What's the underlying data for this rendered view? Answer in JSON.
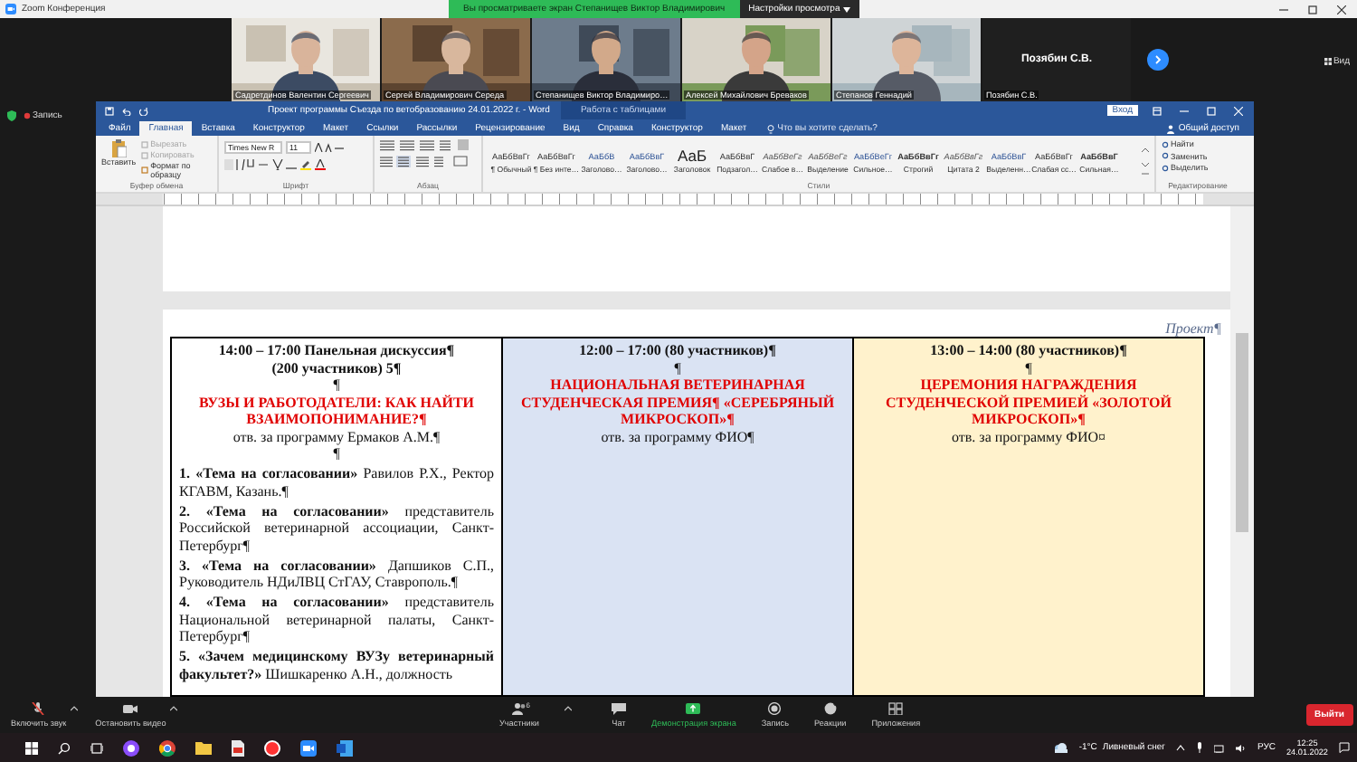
{
  "window": {
    "title": "Zoom Конференция"
  },
  "share_banner": {
    "text": "Вы просматриваете экран Степанищев Виктор Владимирович",
    "menu": "Настройки просмотра"
  },
  "participants": [
    {
      "kind": "video",
      "name": "Садретдинов Валентин Сергеевич"
    },
    {
      "kind": "video",
      "name": "Сергей Владимирович Середа"
    },
    {
      "kind": "video",
      "name": "Степанищев Виктор Владимиро…"
    },
    {
      "kind": "video",
      "name": "Алексей Михайлович Бреваков"
    },
    {
      "kind": "video",
      "name": "Степанов Геннадий"
    },
    {
      "kind": "name",
      "name": "Позябин С.В.",
      "caption": "Позябин С.В."
    }
  ],
  "view_button": "Вид",
  "recording": "Запись",
  "word": {
    "title": "Проект программы Съезда по ветобразованию 24.01.2022 г. - Word",
    "context_tab": "Работа с таблицами",
    "signin": "Вход",
    "tabs": [
      {
        "label": "Файл",
        "selected": false
      },
      {
        "label": "Главная",
        "selected": true
      },
      {
        "label": "Вставка",
        "selected": false
      },
      {
        "label": "Конструктор",
        "selected": false
      },
      {
        "label": "Макет",
        "selected": false
      },
      {
        "label": "Ссылки",
        "selected": false
      },
      {
        "label": "Рассылки",
        "selected": false
      },
      {
        "label": "Рецензирование",
        "selected": false
      },
      {
        "label": "Вид",
        "selected": false
      },
      {
        "label": "Справка",
        "selected": false
      },
      {
        "label": "Конструктор",
        "selected": false
      },
      {
        "label": "Макет",
        "selected": false
      }
    ],
    "tell_me": "Что вы хотите сделать?",
    "share": "Общий доступ",
    "clipboard": {
      "paste": "Вставить",
      "group": "Буфер обмена",
      "items": [
        {
          "label": "Вырезать",
          "disabled": true
        },
        {
          "label": "Копировать",
          "disabled": true
        },
        {
          "label": "Формат по образцу",
          "disabled": false
        }
      ]
    },
    "font": {
      "name": "Times New R",
      "size": "11",
      "group": "Шрифт"
    },
    "paragraph_group": "Абзац",
    "styles": [
      {
        "kind": "normal",
        "sample": "АаБбВвГг",
        "name": "¶ Обычный"
      },
      {
        "kind": "normal",
        "sample": "АаБбВвГг",
        "name": "¶ Без инте…"
      },
      {
        "kind": "heading",
        "sample": "АаБбВ",
        "name": "Заголово…"
      },
      {
        "kind": "heading",
        "sample": "АаБбВвГ",
        "name": "Заголово…"
      },
      {
        "kind": "title",
        "sample": "АаБ",
        "name": "Заголовок"
      },
      {
        "kind": "normal",
        "sample": "АаБбВвГ",
        "name": "Подзагол…"
      },
      {
        "kind": "emphasis",
        "sample": "АаБбВеГг",
        "name": "Слабое в…"
      },
      {
        "kind": "emphasis",
        "sample": "АаБбВеГг",
        "name": "Выделение"
      },
      {
        "kind": "heading",
        "sample": "АаБбВеГг",
        "name": "Сильное…"
      },
      {
        "kind": "strong",
        "sample": "АаБбВвГг",
        "name": "Строгий"
      },
      {
        "kind": "emphasis",
        "sample": "АаБбВвГг",
        "name": "Цитата 2"
      },
      {
        "kind": "heading",
        "sample": "АаБбВвГ",
        "name": "Выделенн…"
      },
      {
        "kind": "normal",
        "sample": "АаБбВвГг",
        "name": "Слабая сс…"
      },
      {
        "kind": "strong",
        "sample": "АаБбВвГ",
        "name": "Сильная…"
      }
    ],
    "styles_group": "Стили",
    "editing": {
      "group": "Редактирование",
      "items": [
        "Найти",
        "Заменить",
        "Выделить"
      ]
    }
  },
  "document": {
    "stamp": "Проект¶",
    "columns": [
      {
        "color": "#ffffff",
        "lines": [
          {
            "kind": "time",
            "text": "14:00 – 17:00 Панельная дискуссия¶"
          },
          {
            "kind": "time",
            "text": "(200 участников) 5¶"
          },
          {
            "kind": "blank",
            "text": "¶"
          },
          {
            "kind": "title",
            "text": "ВУЗЫ И РАБОТОДАТЕЛИ: КАК НАЙТИ ВЗАИМОПОНИМАНИЕ?¶"
          },
          {
            "kind": "owner",
            "text": "отв. за программу Ермаков А.М.¶"
          },
          {
            "kind": "blank",
            "text": "¶"
          },
          {
            "kind": "item",
            "text": "**1. «Тема на согласовании»** Равилов Р.Х., Ректор КГАВМ, Казань.¶"
          },
          {
            "kind": "item",
            "text": "**2. «Тема на согласовании»** представитель Российской ветеринарной ассоциации, Санкт-Петербург¶"
          },
          {
            "kind": "item",
            "text": "**3. «Тема на согласовании»** Дапшиков С.П., Руководитель НДиЛВЦ СтГАУ, Ставрополь.¶"
          },
          {
            "kind": "item",
            "text": "**4. «Тема на согласовании»** представитель Национальной ветеринарной палаты, Санкт-Петербург¶"
          },
          {
            "kind": "item",
            "text": "**5. «Зачем медицинскому ВУЗу ветеринарный факультет?»** Шишкаренко А.Н., должность"
          }
        ]
      },
      {
        "color": "#dae3f3",
        "lines": [
          {
            "kind": "time",
            "text": "12:00 – 17:00 (80 участников)¶"
          },
          {
            "kind": "blank",
            "text": "¶"
          },
          {
            "kind": "title",
            "text": "НАЦИОНАЛЬНАЯ ВЕТЕРИНАРНАЯ СТУДЕНЧЕСКАЯ ПРЕМИЯ¶ «СЕРЕБРЯНЫЙ МИКРОСКОП»¶"
          },
          {
            "kind": "owner",
            "text": "отв. за программу ФИО¶"
          }
        ]
      },
      {
        "color": "#fff2cc",
        "lines": [
          {
            "kind": "time",
            "text": "13:00 – 14:00 (80 участников)¶"
          },
          {
            "kind": "blank",
            "text": "¶"
          },
          {
            "kind": "title",
            "text": "ЦЕРЕМОНИЯ НАГРАЖДЕНИЯ СТУДЕНЧЕСКОЙ ПРЕМИЕЙ «ЗОЛОТОЙ МИКРОСКОП»¶"
          },
          {
            "kind": "owner",
            "text": "отв. за программу ФИО¤"
          }
        ]
      }
    ]
  },
  "meeting_controls": [
    {
      "kind": "mute",
      "label": "Включить звук",
      "highlighted": false
    },
    {
      "kind": "video",
      "label": "Остановить видео",
      "highlighted": false
    },
    {
      "kind": "participants",
      "label": "Участники",
      "count": "6",
      "highlighted": false
    },
    {
      "kind": "chat",
      "label": "Чат",
      "highlighted": false
    },
    {
      "kind": "share",
      "label": "Демонстрация экрана",
      "highlighted": true
    },
    {
      "kind": "record",
      "label": "Запись",
      "highlighted": false
    },
    {
      "kind": "reactions",
      "label": "Реакции",
      "highlighted": false
    },
    {
      "kind": "apps",
      "label": "Приложения",
      "highlighted": false
    }
  ],
  "leave_button": "Выйти",
  "taskbar": {
    "temperature": "-1°C",
    "weather": "Ливневый снег",
    "language": "РУС",
    "time": "12:25",
    "date": "24.01.2022"
  }
}
